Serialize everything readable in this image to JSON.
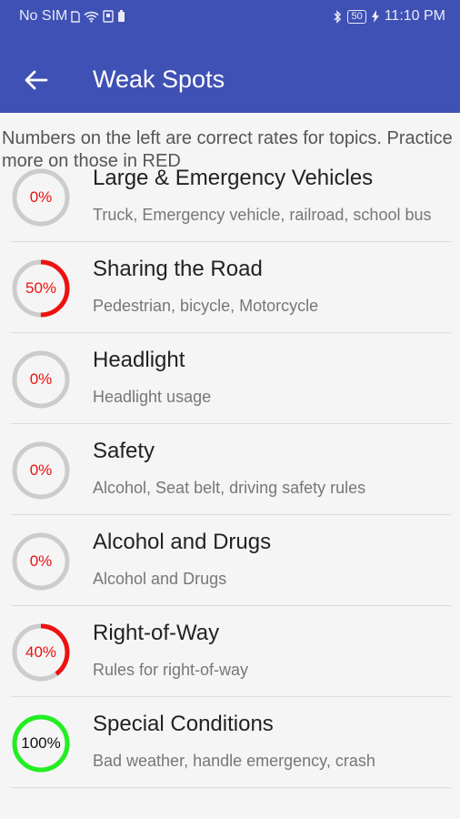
{
  "status_bar": {
    "carrier": "No SIM",
    "battery_level": "50",
    "time": "11:10 PM"
  },
  "toolbar": {
    "title": "Weak Spots",
    "back_icon": "arrow-back-icon"
  },
  "info_text": "Numbers on the left are correct rates for topics. Practice more on those in RED",
  "colors": {
    "app_bar": "#3f51b5",
    "weak": "#ee1111",
    "strong": "#22ee22",
    "track": "#cccccc"
  },
  "topics": [
    {
      "name": "Large & Emergency Vehicles",
      "subtitle": "Truck, Emergency vehicle, railroad, school bus",
      "percent_label": "0%",
      "percent": 0
    },
    {
      "name": "Sharing the Road",
      "subtitle": "Pedestrian, bicycle, Motorcycle",
      "percent_label": "50%",
      "percent": 50
    },
    {
      "name": "Headlight",
      "subtitle": "Headlight usage",
      "percent_label": "0%",
      "percent": 0
    },
    {
      "name": "Safety",
      "subtitle": "Alcohol, Seat belt, driving safety rules",
      "percent_label": "0%",
      "percent": 0
    },
    {
      "name": "Alcohol and Drugs",
      "subtitle": "Alcohol and Drugs",
      "percent_label": "0%",
      "percent": 0
    },
    {
      "name": "Right-of-Way",
      "subtitle": "Rules for right-of-way",
      "percent_label": "40%",
      "percent": 40
    },
    {
      "name": "Special Conditions",
      "subtitle": "Bad weather, handle emergency, crash",
      "percent_label": "100%",
      "percent": 100
    }
  ]
}
